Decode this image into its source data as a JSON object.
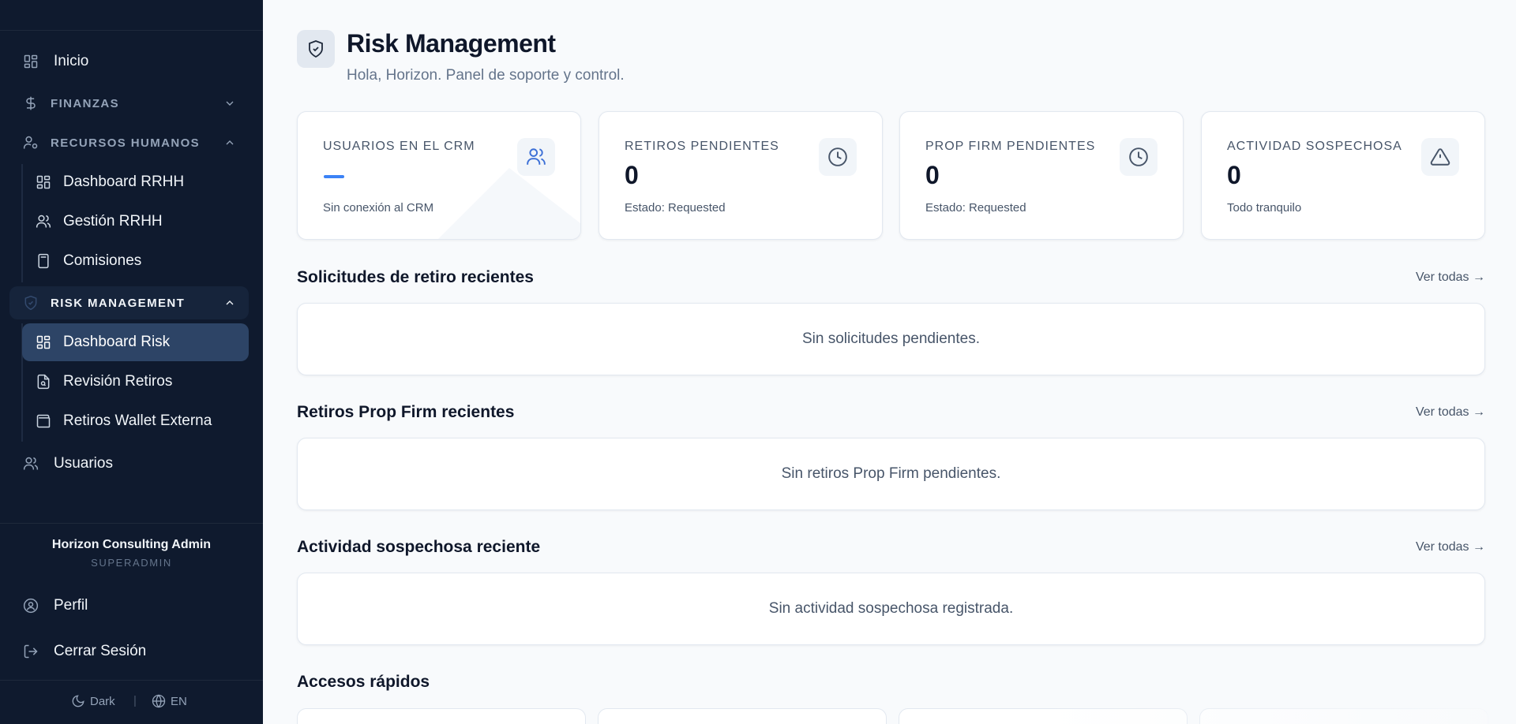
{
  "sidebar": {
    "inicio": "Inicio",
    "finanzas": "FINANZAS",
    "recursos_humanos": "RECURSOS HUMANOS",
    "dashboard_rrhh": "Dashboard RRHH",
    "gestion_rrhh": "Gestión RRHH",
    "comisiones": "Comisiones",
    "risk_management": "RISK MANAGEMENT",
    "dashboard_risk": "Dashboard Risk",
    "revision_retiros": "Revisión Retiros",
    "retiros_wallet_externa": "Retiros Wallet Externa",
    "usuarios": "Usuarios",
    "user_name": "Horizon Consulting Admin",
    "user_role": "SUPERADMIN",
    "perfil": "Perfil",
    "cerrar_sesion": "Cerrar Sesión",
    "theme_label": "Dark",
    "language_label": "EN"
  },
  "header": {
    "title": "Risk Management",
    "subtitle": "Hola, Horizon. Panel de soporte y control."
  },
  "stats": [
    {
      "label": "USUARIOS EN EL CRM",
      "value": "",
      "sub": "Sin conexión al CRM",
      "icon": "users-icon"
    },
    {
      "label": "RETIROS PENDIENTES",
      "value": "0",
      "sub": "Estado: Requested",
      "icon": "clock-icon"
    },
    {
      "label": "PROP FIRM PENDIENTES",
      "value": "0",
      "sub": "Estado: Requested",
      "icon": "clock-icon"
    },
    {
      "label": "ACTIVIDAD SOSPECHOSA",
      "value": "0",
      "sub": "Todo tranquilo",
      "icon": "warning-icon"
    }
  ],
  "sections": [
    {
      "title": "Solicitudes de retiro recientes",
      "link": "Ver todas →",
      "empty": "Sin solicitudes pendientes."
    },
    {
      "title": "Retiros Prop Firm recientes",
      "link": "Ver todas →",
      "empty": "Sin retiros Prop Firm pendientes."
    },
    {
      "title": "Actividad sospechosa reciente",
      "link": "Ver todas →",
      "empty": "Sin actividad sospechosa registrada."
    }
  ],
  "quick_access": {
    "title": "Accesos rápidos"
  },
  "colors": {
    "sidebar_bg": "#0f1a2e",
    "active_item": "#2d4466",
    "accent": "#3b82f6"
  }
}
